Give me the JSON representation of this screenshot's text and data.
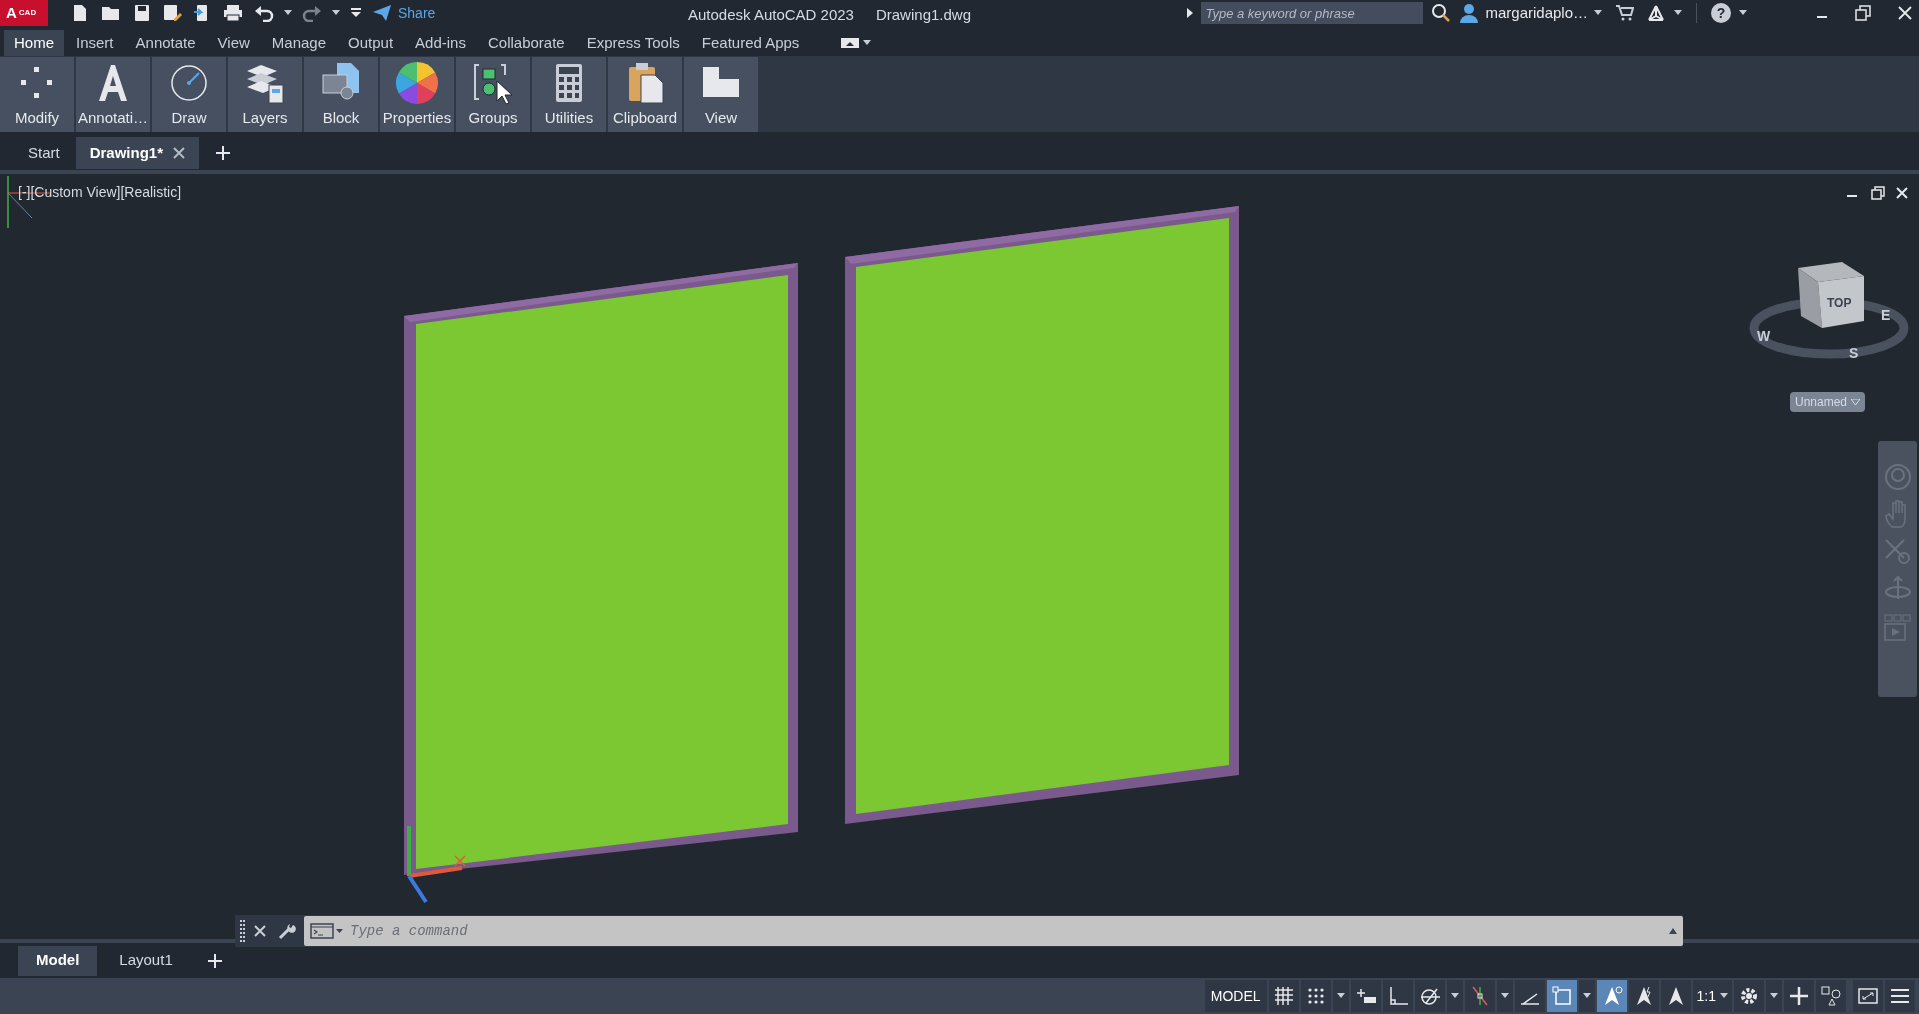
{
  "title_bar": {
    "app_letter": "A",
    "app_badge": "CAD",
    "share": "Share",
    "title": "Autodesk AutoCAD 2023",
    "file": "Drawing1.dwg",
    "search": {
      "placeholder": "Type a keyword or phrase"
    },
    "user": "margaridaplo…",
    "help": "?"
  },
  "ribbon_tabs": [
    {
      "label": "Home",
      "selected": true
    },
    {
      "label": "Insert",
      "selected": false
    },
    {
      "label": "Annotate",
      "selected": false
    },
    {
      "label": "View",
      "selected": false
    },
    {
      "label": "Manage",
      "selected": false
    },
    {
      "label": "Output",
      "selected": false
    },
    {
      "label": "Add-ins",
      "selected": false
    },
    {
      "label": "Collaborate",
      "selected": false
    },
    {
      "label": "Express Tools",
      "selected": false
    },
    {
      "label": "Featured Apps",
      "selected": false
    }
  ],
  "ribbon_panels": [
    {
      "label": "Modify",
      "kind": "modify"
    },
    {
      "label": "Annotati…",
      "kind": "annotation"
    },
    {
      "label": "Draw",
      "kind": "draw"
    },
    {
      "label": "Layers",
      "kind": "layers"
    },
    {
      "label": "Block",
      "kind": "block"
    },
    {
      "label": "Properties",
      "kind": "properties"
    },
    {
      "label": "Groups",
      "kind": "groups"
    },
    {
      "label": "Utilities",
      "kind": "utilities"
    },
    {
      "label": "Clipboard",
      "kind": "clipboard"
    },
    {
      "label": "View",
      "kind": "view"
    }
  ],
  "file_tabs": [
    {
      "label": "Start",
      "selected": false
    },
    {
      "label": "Drawing1*",
      "selected": true
    }
  ],
  "viewport": {
    "label": "[-][Custom View][Realistic]",
    "viewcube": {
      "face": "TOP",
      "compass": [
        "W",
        "S",
        "E"
      ],
      "view_name": "Unnamed"
    }
  },
  "command_line": {
    "placeholder": "Type a command"
  },
  "layout_tabs": [
    {
      "label": "Model",
      "selected": true
    },
    {
      "label": "Layout1",
      "selected": false
    }
  ],
  "status_bar": {
    "model": "MODEL",
    "scale": "1:1",
    "toggles": [
      {
        "kind": "grid",
        "on": false
      },
      {
        "kind": "snap",
        "on": false
      },
      {
        "kind": "infer",
        "on": false
      },
      {
        "kind": "ortho",
        "on": false
      },
      {
        "kind": "polar",
        "on": false
      },
      {
        "kind": "osnap-track",
        "on": false
      },
      {
        "kind": "isodraft",
        "on": false
      },
      {
        "kind": "selection-cycling",
        "on": true
      },
      {
        "kind": "annotation-visibility",
        "on": true
      },
      {
        "kind": "auto-scale",
        "on": false
      }
    ]
  }
}
